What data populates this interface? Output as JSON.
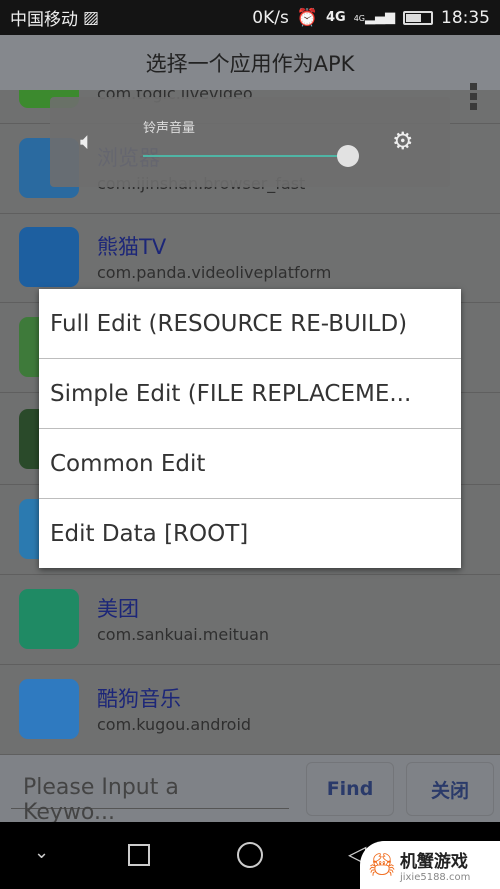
{
  "status": {
    "carrier": "中国移动",
    "speed": "0K/s",
    "network": "4G",
    "network2": "4G",
    "time": "18:35"
  },
  "toolbar": {
    "title": "选择一个应用作为APK"
  },
  "apps": [
    {
      "title": "",
      "package": "com.togic.livevideo",
      "color": "#3c8a2e"
    },
    {
      "title": "浏览器",
      "package": "com.ijinshan.browser_fast",
      "color": "#2a6aa0"
    },
    {
      "title": "熊猫TV",
      "package": "com.panda.videoliveplatform",
      "color": "#1d5fa0"
    },
    {
      "title": "",
      "package": "",
      "color": "#3e7a3a"
    },
    {
      "title": "",
      "package": "",
      "color": "#2a4a2a"
    },
    {
      "title": "",
      "package": "",
      "color": "#2b7ab0"
    },
    {
      "title": "美团",
      "package": "com.sankuai.meituan",
      "color": "#1f8a64"
    },
    {
      "title": "酷狗音乐",
      "package": "com.kugou.android",
      "color": "#2f7ac0"
    }
  ],
  "volume": {
    "label": "铃声音量",
    "level": 1.0
  },
  "dialog": {
    "items": [
      "Full Edit (RESOURCE RE-BUILD)",
      "Simple Edit (FILE REPLACEME...",
      "Common Edit",
      "Edit Data [ROOT]"
    ]
  },
  "bottom": {
    "search_placeholder": "Please Input a Keywo...",
    "find": "Find",
    "close": "关闭"
  },
  "watermark": {
    "text": "机蟹游戏",
    "url": "jixie5188.com"
  }
}
